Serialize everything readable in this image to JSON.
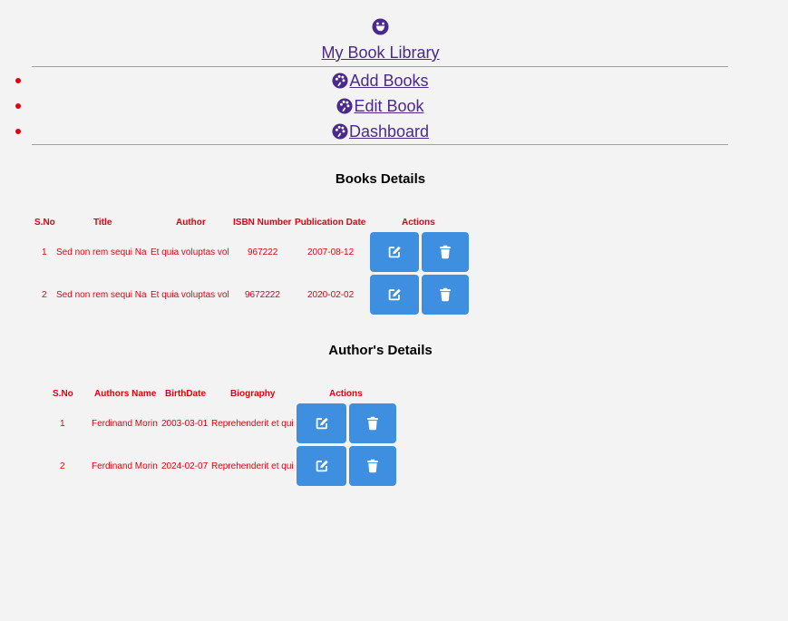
{
  "header": {
    "brand": "My Book Library",
    "logo_icon": "smiley-face-icon"
  },
  "nav": {
    "items": [
      {
        "label": "Add Books",
        "icon": "palette-icon"
      },
      {
        "label": "Edit Book",
        "icon": "palette-icon"
      },
      {
        "label": "Dashboard",
        "icon": "palette-icon"
      }
    ]
  },
  "books": {
    "title": "Books Details",
    "columns": [
      "S.No",
      "Title",
      "Author",
      "ISBN Number",
      "Publication Date",
      "Actions"
    ],
    "rows": [
      {
        "sno": "1",
        "title": "Sed non rem sequi Na",
        "author": "Et quia voluptas vol",
        "isbn": "967222",
        "date": "2007-08-12"
      },
      {
        "sno": "2",
        "title": "Sed non rem sequi Na",
        "author": "Et quia voluptas vol",
        "isbn": "9672222",
        "date": "2020-02-02"
      }
    ]
  },
  "authors": {
    "title": "Author's Details",
    "columns": [
      "S.No",
      "Authors Name",
      "BirthDate",
      "Biography",
      "Actions"
    ],
    "rows": [
      {
        "sno": "1",
        "name": "Ferdinand Morin",
        "birth": "2003-03-01",
        "bio": "Reprehenderit et qui"
      },
      {
        "sno": "2",
        "name": "Ferdinand Morin",
        "birth": "2024-02-07",
        "bio": "Reprehenderit et qui"
      }
    ]
  },
  "colors": {
    "background": "#f3f3f3",
    "link": "#4b2a8c",
    "table_text": "#e3000f",
    "button": "#3e8fdf"
  },
  "icons": {
    "edit": "edit-icon",
    "delete": "trash-icon"
  }
}
